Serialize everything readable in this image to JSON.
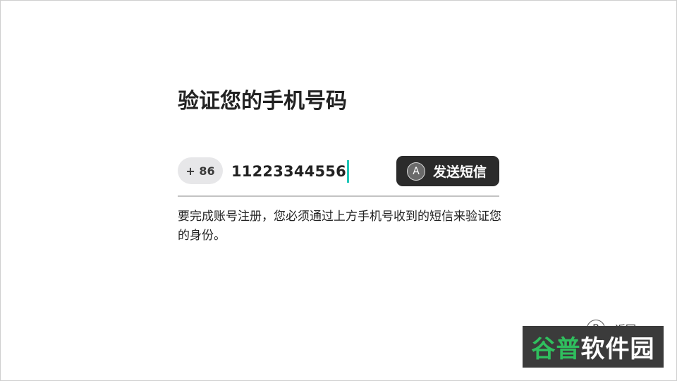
{
  "page": {
    "title": "验证您的手机号码",
    "description": "要完成账号注册，您必须通过上方手机号收到的短信来验证您的身份。"
  },
  "phone": {
    "country_code": "+ 86",
    "number": "11223344556"
  },
  "send_button": {
    "key_hint": "A",
    "label": "发送短信"
  },
  "back_button": {
    "key_hint": "B",
    "label": "返回"
  },
  "watermark": {
    "part1": "谷普",
    "part2": "软件园"
  },
  "colors": {
    "caret": "#1fc6b8",
    "button_bg": "#2b2b2b",
    "chip_bg": "#e7e7e9",
    "watermark_green": "#2fbf5e"
  }
}
